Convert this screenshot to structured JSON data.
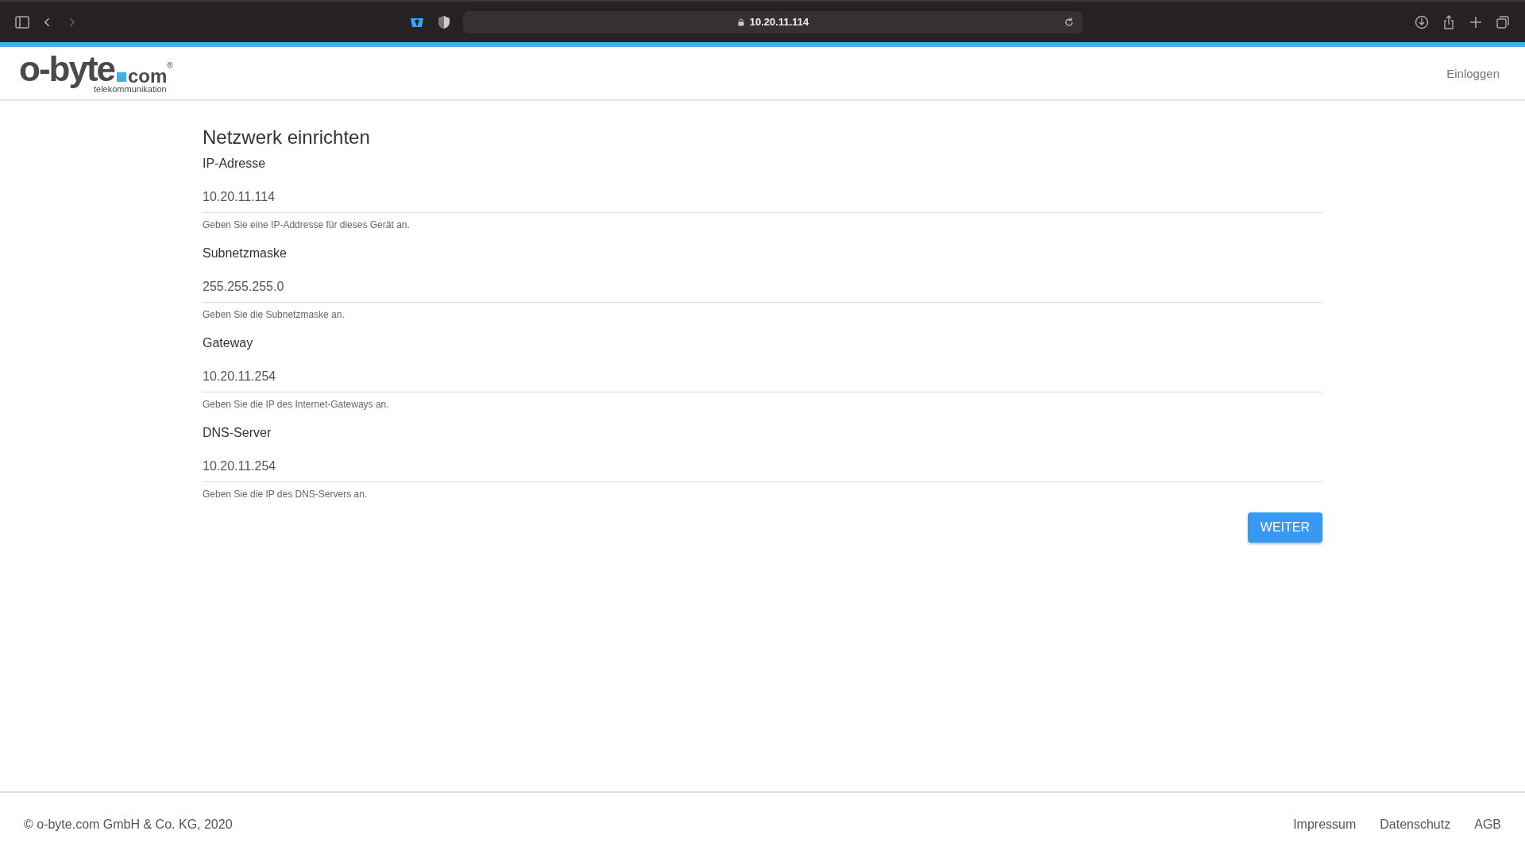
{
  "browser": {
    "url": "10.20.11.114"
  },
  "header": {
    "logo": {
      "name": "o-byte",
      "suffix": "com",
      "mark": "®",
      "tagline": "telekommunikation"
    },
    "login": "Einloggen"
  },
  "form": {
    "title": "Netzwerk einrichten",
    "fields": [
      {
        "label": "IP-Adresse",
        "value": "10.20.11.114",
        "hint": "Geben Sie eine IP-Addresse für dieses Gerät an."
      },
      {
        "label": "Subnetzmaske",
        "value": "255.255.255.0",
        "hint": "Geben Sie die Subnetzmaske an."
      },
      {
        "label": "Gateway",
        "value": "10.20.11.254",
        "hint": "Geben Sie die IP des Internet-Gateways an."
      },
      {
        "label": "DNS-Server",
        "value": "10.20.11.254",
        "hint": "Geben Sie die IP des DNS-Servers an."
      }
    ],
    "submit": "WEITER"
  },
  "footer": {
    "copyright": "© o-byte.com GmbH & Co. KG, 2020",
    "links": [
      "Impressum",
      "Datenschutz",
      "AGB"
    ]
  }
}
